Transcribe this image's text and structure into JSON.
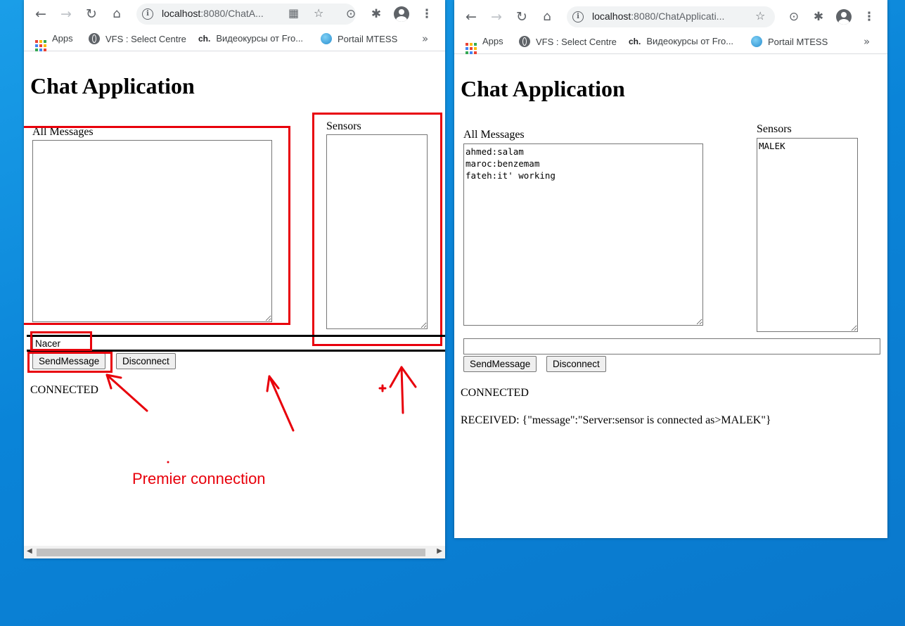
{
  "left_window": {
    "url_host": "localhost",
    "url_path": ":8080/ChatA...",
    "bookmarks": {
      "apps": "Apps",
      "vfs": "VFS : Select Centre",
      "ch": "Видеокурсы от Fro...",
      "portail": "Portail MTESS",
      "more": "»"
    },
    "page": {
      "title": "Chat Application",
      "all_messages_label": "All Messages",
      "messages": "",
      "sensors_label": "Sensors",
      "sensors": "",
      "message_input_value": "Nacer",
      "send_button": "SendMessage",
      "disconnect_button": "Disconnect",
      "status": "CONNECTED"
    },
    "annotation": {
      "caption": "Premier connection",
      "color": "#e8000b"
    }
  },
  "right_window": {
    "url_host": "localhost",
    "url_path": ":8080/ChatApplicati...",
    "bookmarks": {
      "apps": "Apps",
      "vfs": "VFS : Select Centre",
      "ch": "Видеокурсы от Fro...",
      "portail": "Portail MTESS",
      "more": "»"
    },
    "page": {
      "title": "Chat Application",
      "all_messages_label": "All Messages",
      "messages": "ahmed:salam\nmaroc:benzemam\nfateh:it' working",
      "sensors_label": "Sensors",
      "sensors": "MALEK",
      "message_input_value": "",
      "send_button": "SendMessage",
      "disconnect_button": "Disconnect",
      "status": "CONNECTED",
      "received": "RECEIVED: {\"message\":\"Server:sensor is connected as>MALEK\"}"
    }
  },
  "colors": {
    "desktop": "#0a84d8",
    "annotation_red": "#e8000b"
  }
}
